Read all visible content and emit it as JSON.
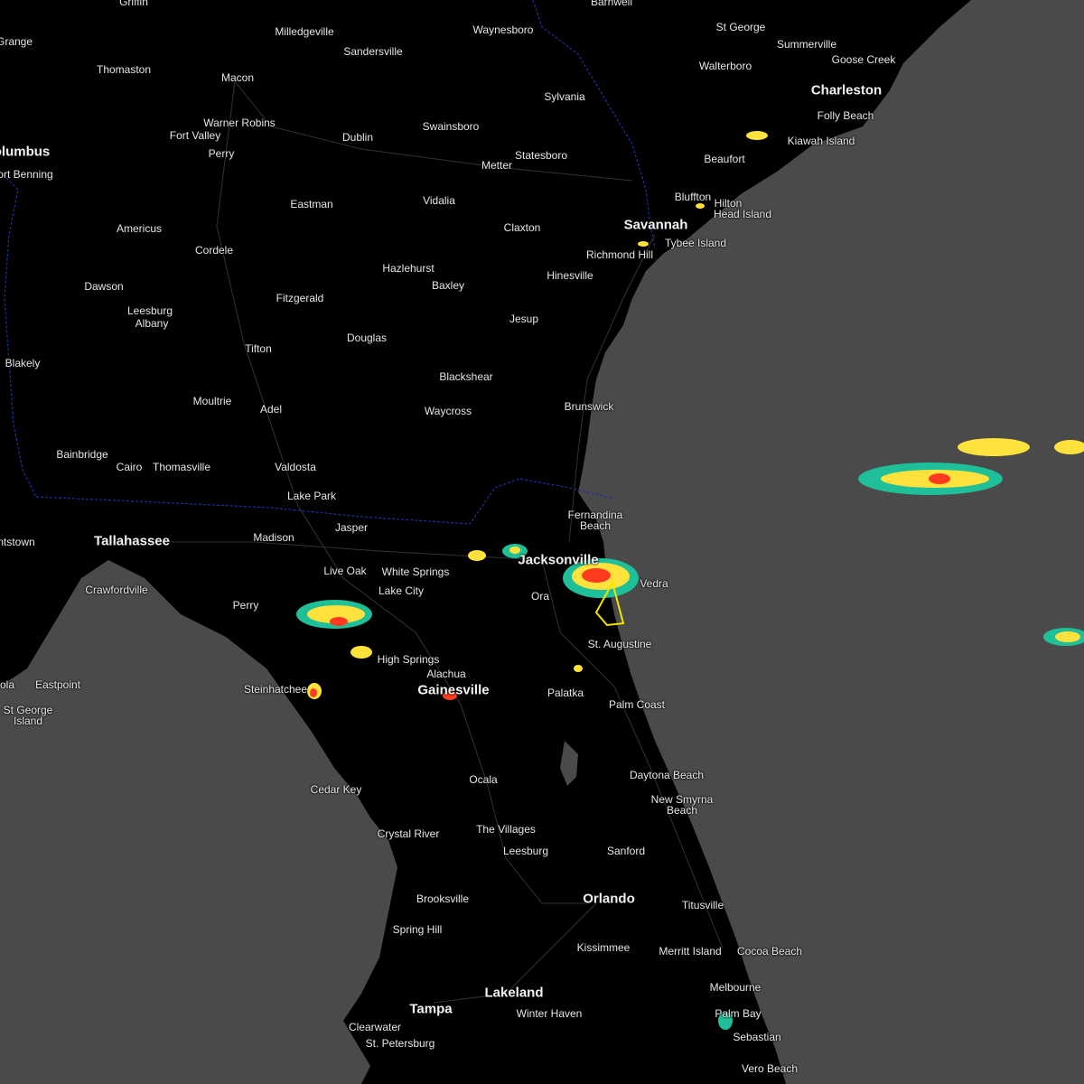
{
  "map": {
    "title": "",
    "colors": {
      "ocean": "#4a4a4a",
      "land": "#000000",
      "roads": "#3a3a3a",
      "state_border": "#1f2fa0",
      "warning_polygon": "#f2e600",
      "radar_low": "#1fbf9a",
      "radar_mid": "#ffe23b",
      "radar_high": "#ff3b1f"
    },
    "cities": {
      "griffin": "Griffin",
      "lagrange": "Grange",
      "milledgeville": "Milledgeville",
      "sandersville": "Sandersville",
      "waynesboro": "Waynesboro",
      "barnwell": "Barnwell",
      "st_george": "St George",
      "summerville": "Summerville",
      "goose_creek": "Goose Creek",
      "thomaston": "Thomaston",
      "macon": "Macon",
      "walterboro": "Walterboro",
      "charleston": "Charleston",
      "sylvania": "Sylvania",
      "folly_beach": "Folly Beach",
      "warner_robins": "Warner Robins",
      "fort_valley": "Fort Valley",
      "dublin": "Dublin",
      "swainsboro": "Swainsboro",
      "kiawah_island": "Kiawah Island",
      "columbus": "olumbus",
      "fort_benning": "ort Benning",
      "perry_ga": "Perry",
      "statesboro": "Statesboro",
      "metter": "Metter",
      "beaufort": "Beaufort",
      "eastman": "Eastman",
      "vidalia": "Vidalia",
      "bluffton": "Bluffton",
      "hilton_head": "Hilton",
      "hilton_head_2": "Head Island",
      "americus": "Americus",
      "claxton": "Claxton",
      "savannah": "Savannah",
      "tybee_island": "Tybee Island",
      "cordele": "Cordele",
      "richmond_hill": "Richmond Hill",
      "hazlehurst": "Hazlehurst",
      "hinesville": "Hinesville",
      "dawson": "Dawson",
      "baxley": "Baxley",
      "leesburg_ga": "Leesburg",
      "fitzgerald": "Fitzgerald",
      "albany": "Albany",
      "jesup": "Jesup",
      "douglas": "Douglas",
      "tifton": "Tifton",
      "blakely": "Blakely",
      "blackshear": "Blackshear",
      "moultrie": "Moultrie",
      "brunswick": "Brunswick",
      "adel": "Adel",
      "waycross": "Waycross",
      "bainbridge": "Bainbridge",
      "cairo": "Cairo",
      "thomasville": "Thomasville",
      "valdosta": "Valdosta",
      "lake_park": "Lake Park",
      "fernandina": "Fernandina",
      "fernandina_2": "Beach",
      "jasper": "Jasper",
      "blountstown": "ntstown",
      "tallahassee": "Tallahassee",
      "madison": "Madison",
      "jacksonville": "Jacksonville",
      "live_oak": "Live Oak",
      "white_springs": "White Springs",
      "vedra": "Vedra",
      "crawfordville": "Crawfordville",
      "lake_city": "Lake City",
      "orange_park": "Ora",
      "perry_fl": "Perry",
      "st_augustine": "St. Augustine",
      "high_springs": "High Springs",
      "alachua": "Alachua",
      "apalachicola": "ola",
      "eastpoint": "Eastpoint",
      "steinhatchee": "Steinhatchee",
      "gainesville": "Gainesville",
      "palatka": "Palatka",
      "st_george_island": "St George",
      "st_george_island_2": "Island",
      "palm_coast": "Palm Coast",
      "daytona": "Daytona Beach",
      "cedar_key": "Cedar Key",
      "ocala": "Ocala",
      "new_smyrna": "New Smyrna",
      "new_smyrna_2": "Beach",
      "the_villages": "The Villages",
      "crystal_river": "Crystal River",
      "leesburg_fl": "Leesburg",
      "sanford": "Sanford",
      "orlando": "Orlando",
      "brooksville": "Brooksville",
      "titusville": "Titusville",
      "spring_hill": "Spring Hill",
      "kissimmee": "Kissimmee",
      "merritt_island": "Merritt Island",
      "cocoa_beach": "Cocoa Beach",
      "melbourne": "Melbourne",
      "lakeland": "Lakeland",
      "tampa": "Tampa",
      "winter_haven": "Winter Haven",
      "palm_bay": "Palm Bay",
      "clearwater": "Clearwater",
      "st_petersburg": "St. Petersburg",
      "sebastian": "Sebastian",
      "vero_beach": "Vero Beach"
    }
  }
}
